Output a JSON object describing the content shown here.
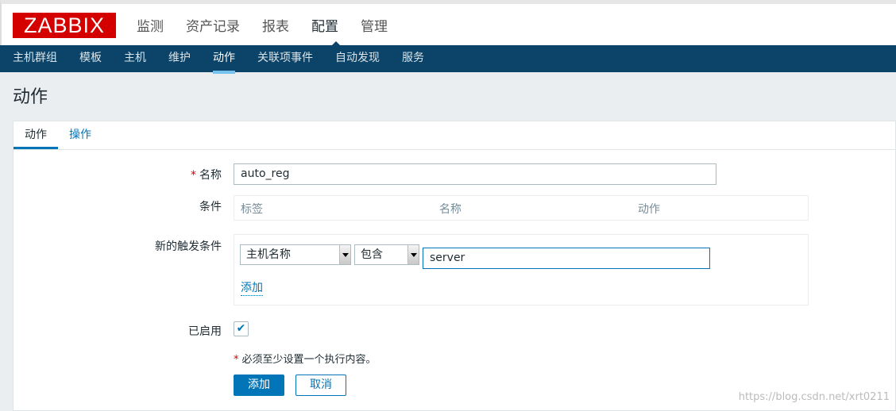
{
  "logo": "ZABBIX",
  "main_menu": [
    "监测",
    "资产记录",
    "报表",
    "配置",
    "管理"
  ],
  "main_menu_active": "配置",
  "sub_nav": [
    "主机群组",
    "模板",
    "主机",
    "维护",
    "动作",
    "关联项事件",
    "自动发现",
    "服务"
  ],
  "sub_nav_active": "动作",
  "page_title": "动作",
  "tabs": [
    "动作",
    "操作"
  ],
  "form": {
    "name_label": "名称",
    "name_value": "auto_reg",
    "conditions_label": "条件",
    "conditions_headers": [
      "标签",
      "名称",
      "动作"
    ],
    "new_condition_label": "新的触发条件",
    "condition_type": "主机名称",
    "condition_operator": "包含",
    "condition_value": "server",
    "add_link": "添加",
    "enabled_label": "已启用",
    "enabled": true,
    "warning": "必须至少设置一个执行内容。",
    "add_button": "添加",
    "cancel_button": "取消"
  },
  "watermark": "https://blog.csdn.net/xrt0211",
  "colors": {
    "nav": "#0b4468",
    "accent": "#0275b8",
    "logo": "#d40000"
  }
}
